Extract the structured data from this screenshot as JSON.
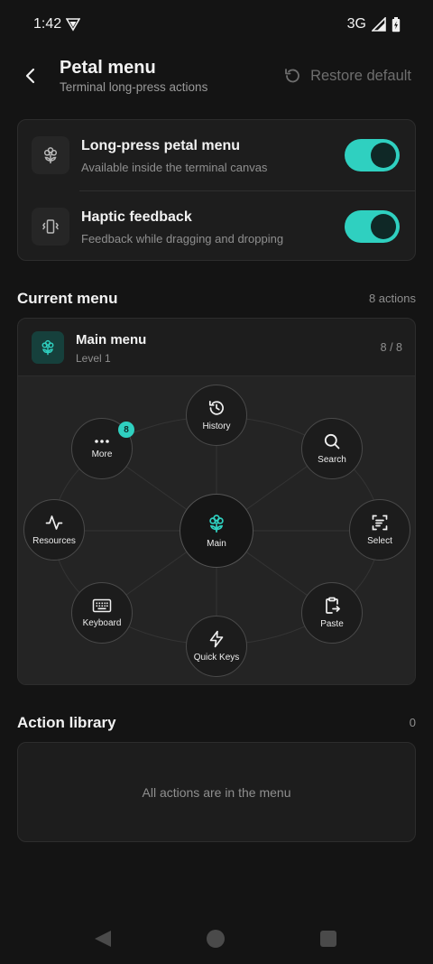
{
  "status": {
    "time": "1:42",
    "network": "3G"
  },
  "header": {
    "title": "Petal menu",
    "subtitle": "Terminal long-press actions",
    "restore_label": "Restore default"
  },
  "settings": [
    {
      "title": "Long-press petal menu",
      "subtitle": "Available inside the terminal canvas",
      "icon": "flower-icon",
      "enabled": true
    },
    {
      "title": "Haptic feedback",
      "subtitle": "Feedback while dragging and dropping",
      "icon": "vibration-icon",
      "enabled": true
    }
  ],
  "current_menu": {
    "section_title": "Current menu",
    "count_text": "8 actions",
    "name": "Main menu",
    "level": "Level 1",
    "ratio": "8 / 8",
    "center_label": "Main",
    "petals": [
      {
        "label": "History",
        "icon": "history-icon"
      },
      {
        "label": "Search",
        "icon": "search-icon"
      },
      {
        "label": "Select",
        "icon": "select-icon"
      },
      {
        "label": "Paste",
        "icon": "paste-icon"
      },
      {
        "label": "Quick Keys",
        "icon": "lightning-icon"
      },
      {
        "label": "Keyboard",
        "icon": "keyboard-icon"
      },
      {
        "label": "Resources",
        "icon": "activity-icon"
      },
      {
        "label": "More",
        "icon": "more-icon",
        "badge": "8"
      }
    ]
  },
  "library": {
    "section_title": "Action library",
    "count_text": "0",
    "empty_text": "All actions are in the menu"
  },
  "colors": {
    "accent": "#2fd0c0",
    "background": "#141414",
    "card": "#1d1d1d"
  }
}
